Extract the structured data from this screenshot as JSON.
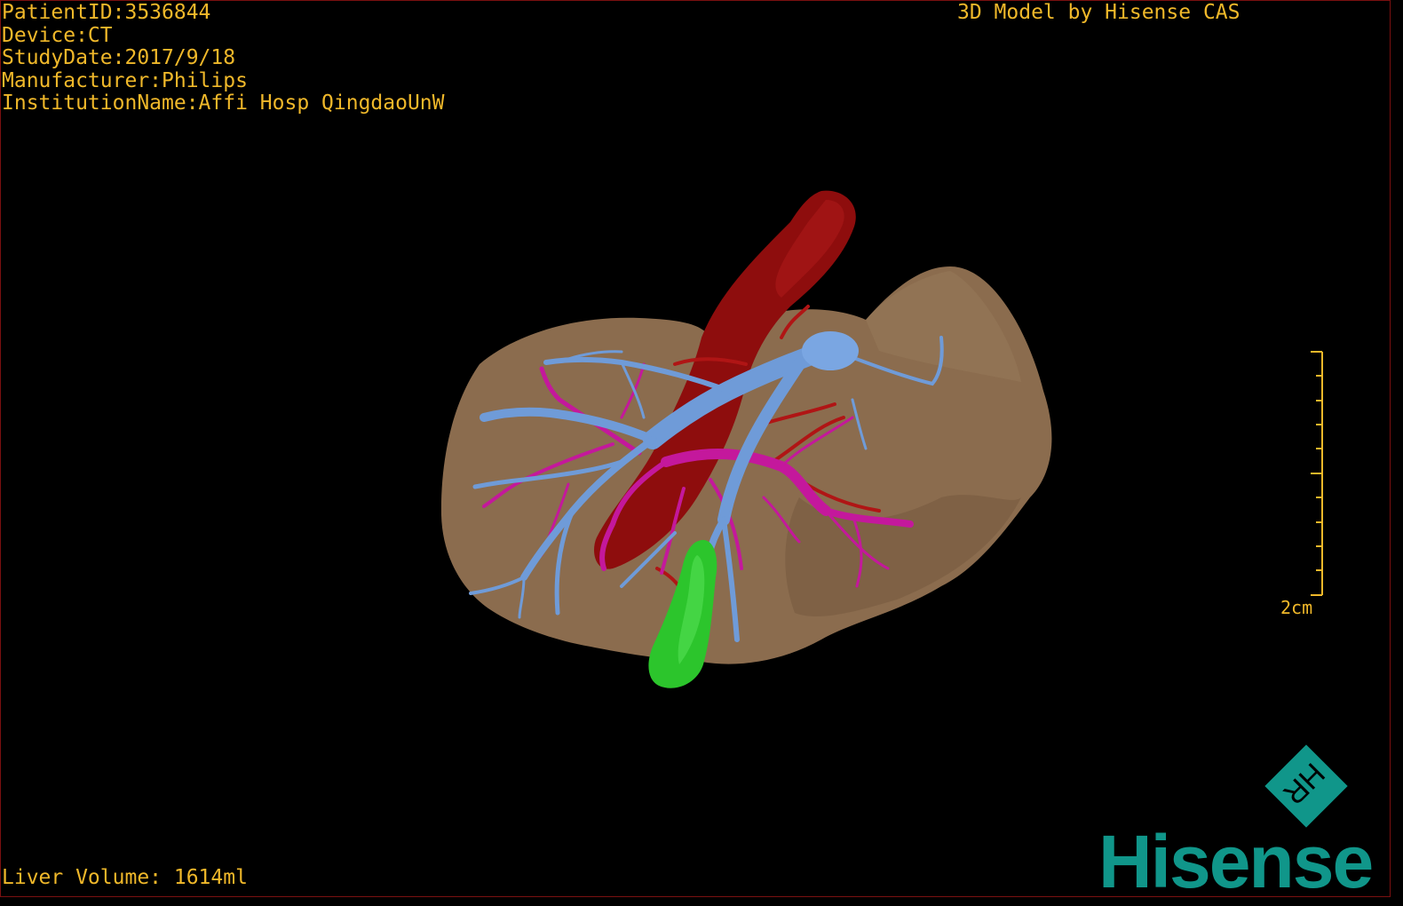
{
  "header": {
    "patient_id": "PatientID:3536844",
    "device": "Device:CT",
    "study_date": "StudyDate:2017/9/18",
    "manufacturer": "Manufacturer:Philips",
    "institution": "InstitutionName:Affi Hosp QingdaoUnW"
  },
  "brand_top": "3D Model by Hisense CAS",
  "footer": {
    "liver_volume": "Liver Volume: 1614ml"
  },
  "scale_bar": {
    "label": "2cm"
  },
  "logo": {
    "word": "Hisense",
    "mark": "HR"
  },
  "colors": {
    "text": "#f0b82a",
    "liver": "#8b6c4e",
    "aorta": "#8e0d0d",
    "portal_vein": "#6f9bd8",
    "hepatic_artery": "#c4189c",
    "gallbladder": "#2cc52c",
    "brand": "#10968a"
  }
}
